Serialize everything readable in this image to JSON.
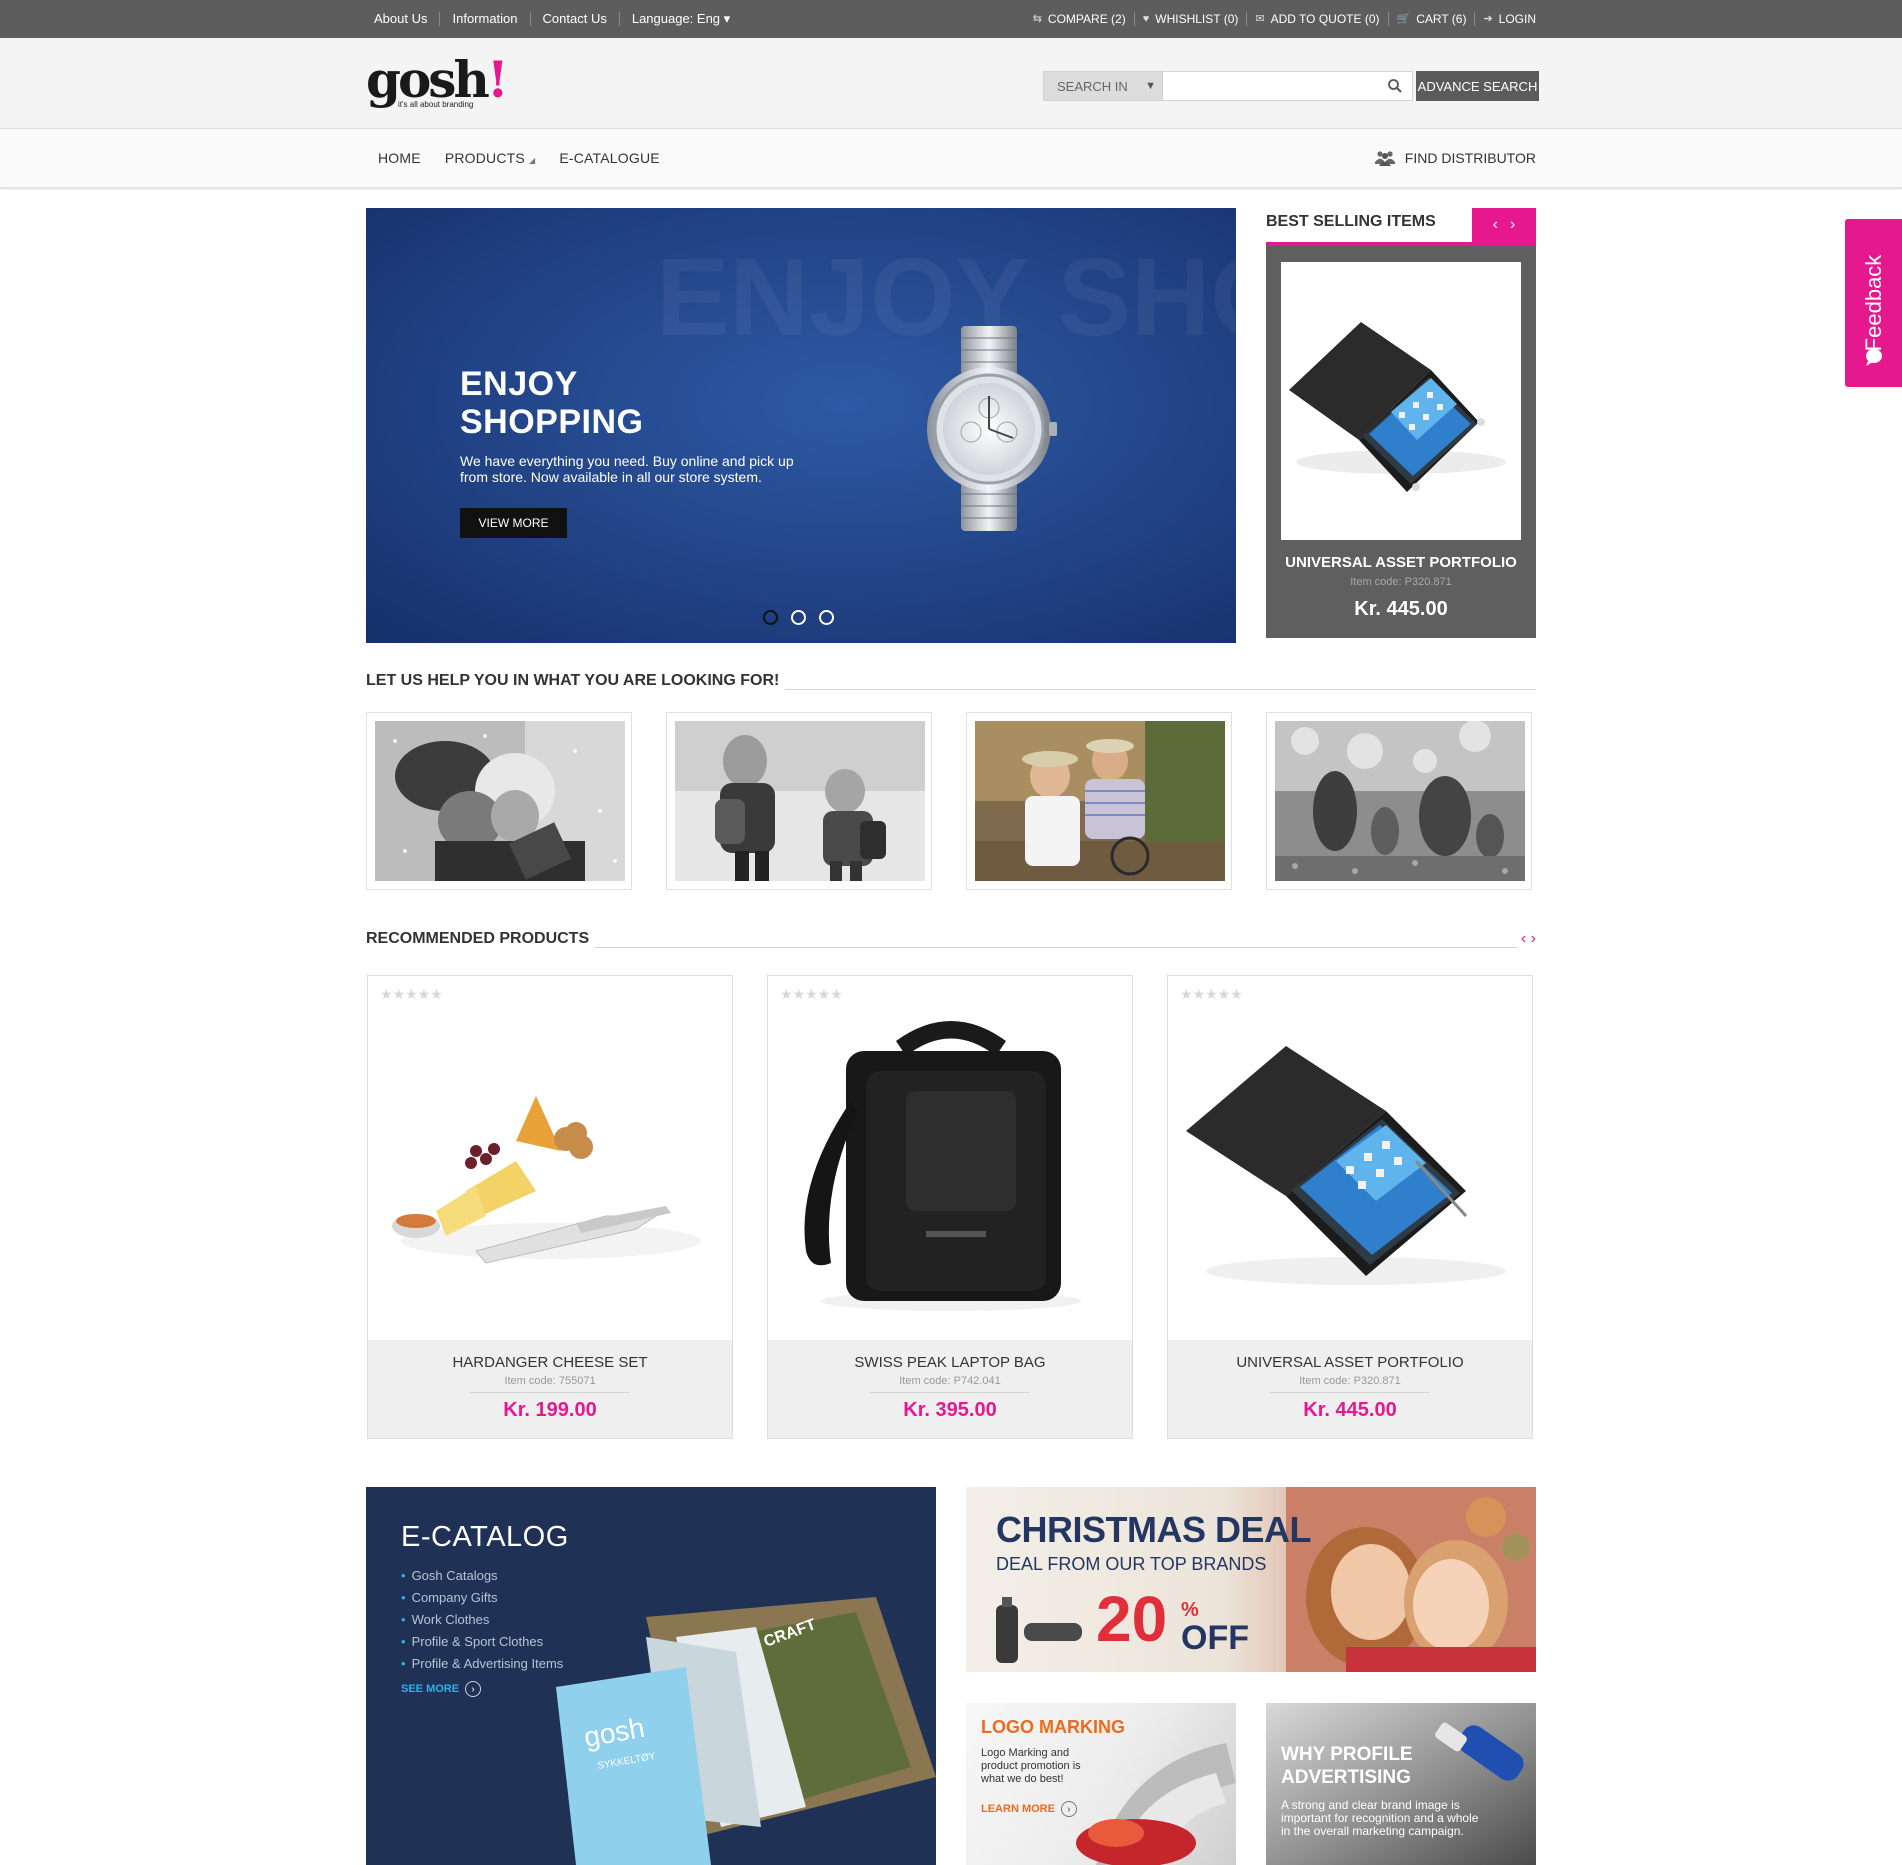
{
  "topbar": {
    "links": [
      "About Us",
      "Information",
      "Contact Us",
      "Language: Eng ▾"
    ],
    "right": [
      {
        "icon": "compare-icon",
        "label": "COMPARE (2)"
      },
      {
        "icon": "heart-icon",
        "label": "WHISHLIST (0)"
      },
      {
        "icon": "quote-icon",
        "label": "ADD TO QUOTE (0)"
      },
      {
        "icon": "cart-icon",
        "label": "CART (6)"
      },
      {
        "icon": "login-icon",
        "label": "LOGIN"
      }
    ]
  },
  "header": {
    "logo_word": "gosh",
    "logo_bang": "!",
    "logo_tagline": "it's all about branding",
    "search_scope": "SEARCH IN",
    "search_placeholder": "",
    "advance_search": "ADVANCE SEARCH"
  },
  "nav": {
    "items": [
      "HOME",
      "PRODUCTS",
      "E-CATALOGUE"
    ],
    "find_distributor": "FIND DISTRIBUTOR"
  },
  "feedback": "Feedback",
  "hero": {
    "ghost_text": "ENJOY SHOPPIN",
    "title_line1": "ENJOY",
    "title_line2": "SHOPPING",
    "text": "We have everything you need. Buy online and pick up from store. Now available in all our store system.",
    "button": "VIEW MORE",
    "slides": 3,
    "active_slide": 1
  },
  "best_selling": {
    "title": "BEST SELLING ITEMS",
    "product": {
      "name": "UNIVERSAL ASSET PORTFOLIO",
      "code": "Item code: P320.871",
      "price": "Kr. 445.00"
    }
  },
  "help": {
    "title": "LET US HELP YOU IN WHAT YOU ARE LOOKING FOR!"
  },
  "recommended": {
    "title": "RECOMMENDED PRODUCTS",
    "stars": "★★★★★",
    "products": [
      {
        "name": "HARDANGER CHEESE SET",
        "code": "Item code: 755071",
        "price": "Kr. 199.00"
      },
      {
        "name": "SWISS PEAK LAPTOP BAG",
        "code": "Item code: P742.041",
        "price": "Kr. 395.00"
      },
      {
        "name": "UNIVERSAL ASSET PORTFOLIO",
        "code": "Item code: P320.871",
        "price": "Kr. 445.00"
      }
    ]
  },
  "ecatalog": {
    "title": "E-CATALOG",
    "items": [
      "Gosh Catalogs",
      "Company Gifts",
      "Work Clothes",
      "Profile & Sport Clothes",
      "Profile & Advertising Items"
    ],
    "see_more": "SEE MORE",
    "book_brand": "gosh",
    "book_sub": "SYKKELTØY",
    "book_craft": "CRAFT"
  },
  "christmas": {
    "title": "CHRISTMAS DEAL",
    "subtitle": "DEAL FROM OUR TOP BRANDS",
    "discount": "20",
    "percent": "%",
    "off": "OFF"
  },
  "logo_marking": {
    "title": "LOGO MARKING",
    "text": "Logo Marking and product promotion is what we do best!",
    "link": "LEARN MORE"
  },
  "why_profile": {
    "title_line1": "WHY PROFILE",
    "title_line2": "ADVERTISING",
    "text": "A strong and clear brand image is important for recognition and a whole in the overall marketing campaign."
  },
  "colors": {
    "accent": "#e5188d",
    "topbar": "#5d5d5d",
    "hero": "#24478b",
    "ecatalog": "#1f3256"
  }
}
